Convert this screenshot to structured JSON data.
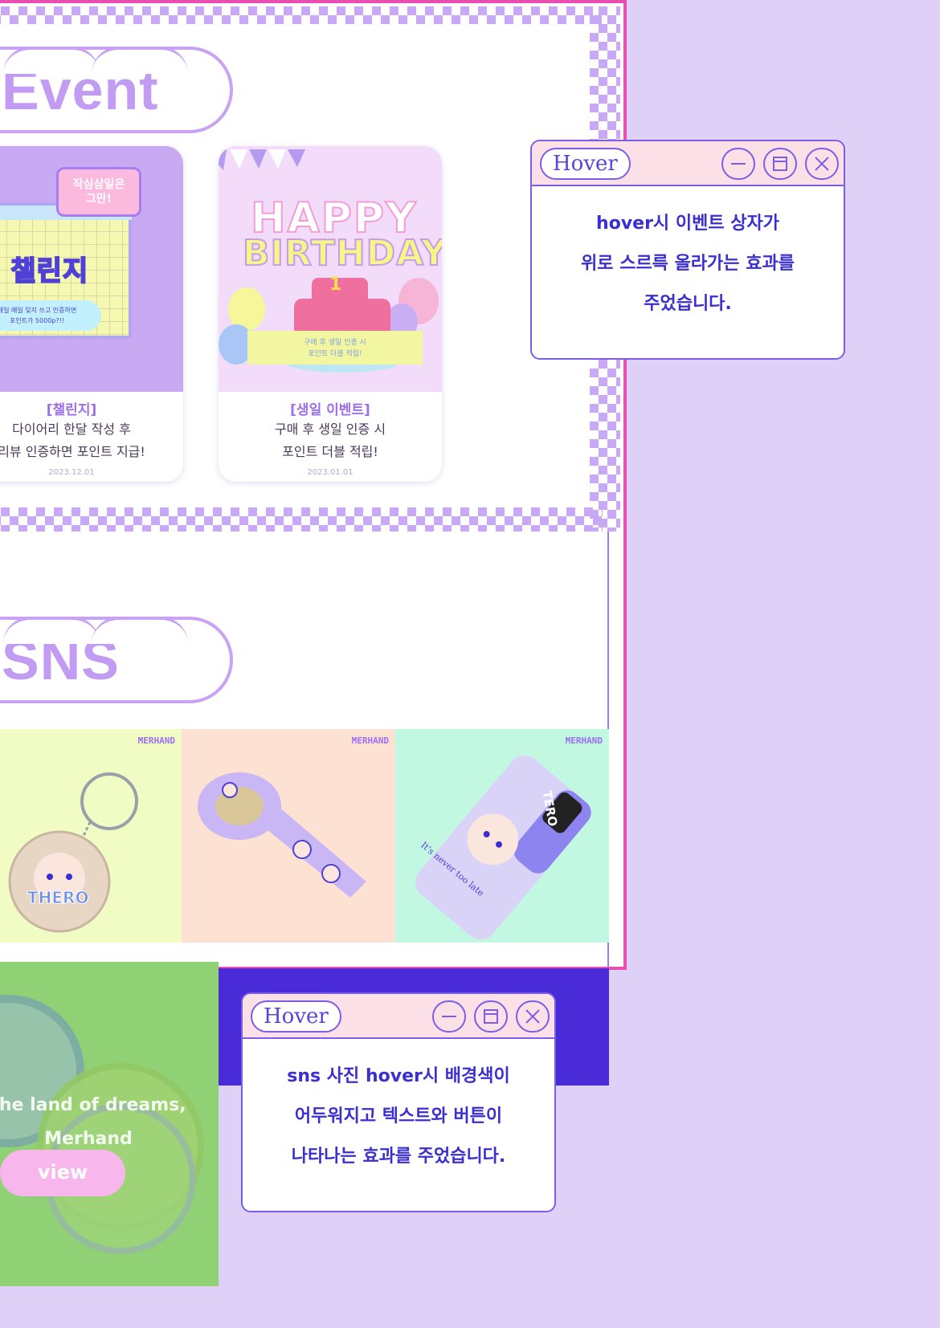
{
  "event": {
    "title": "Event",
    "cards": [
      {
        "category": "[챌린지]",
        "desc_line1": "다이어리 한달 작성 후",
        "desc_line2": "리뷰 인증하면 포인트 지급!",
        "date": "2023.12.01",
        "thumb_bubble_line1": "작심삼일은",
        "thumb_bubble_line2": "그만!",
        "thumb_title": "갓생 챌린지",
        "thumb_pill_line1": "매일 매일 잊지 쓰고 인증하면",
        "thumb_pill_line2": "포인트가 5000p?!!"
      },
      {
        "category": "[생일 이벤트]",
        "desc_line1": "구매 후 생일 인증 시",
        "desc_line2": "포인트 더블 적립!",
        "date": "2023.01.01",
        "thumb_happy": "HAPPY",
        "thumb_birthday": "BIRTHDAY",
        "thumb_ribbon_line1": "구매 후 생일 인증 시",
        "thumb_ribbon_line2": "포인트 더블 적립!",
        "thumb_cake_number": "1"
      }
    ]
  },
  "hover_event": {
    "label": "Hover",
    "line1": "hover시 이벤트 상자가",
    "line2": "위로 스르륵 올라가는 효과를",
    "line3": "주었습니다."
  },
  "sns": {
    "title": "SNS",
    "brand_text": "MERHAND",
    "tiles": [
      {
        "name": "keyring",
        "label": "THERO",
        "bg": "#f1fcc5"
      },
      {
        "name": "masking-tape",
        "bg": "#fde2d4"
      },
      {
        "name": "phone-case",
        "label": "TERO",
        "caption": "It's never too late",
        "bg": "#c2f8e2"
      }
    ],
    "hover_tile": {
      "line1": "the land of dreams,",
      "line2": "Merhand",
      "button": "view"
    }
  },
  "hover_sns": {
    "label": "Hover",
    "line1": "sns 사진 hover시 배경색이",
    "line2": "어두워지고 텍스트와 버튼이",
    "line3": "나타나는 효과를 주었습니다."
  },
  "colors": {
    "background": "#dfd0f7",
    "frame_pink": "#e94fb1",
    "accent_purple": "#c29bf2",
    "window_border": "#7a5fe6",
    "deep_purple": "#4a2bd8"
  },
  "icons": {
    "minimize": "minimize-icon",
    "maximize": "maximize-icon",
    "close": "close-icon"
  }
}
